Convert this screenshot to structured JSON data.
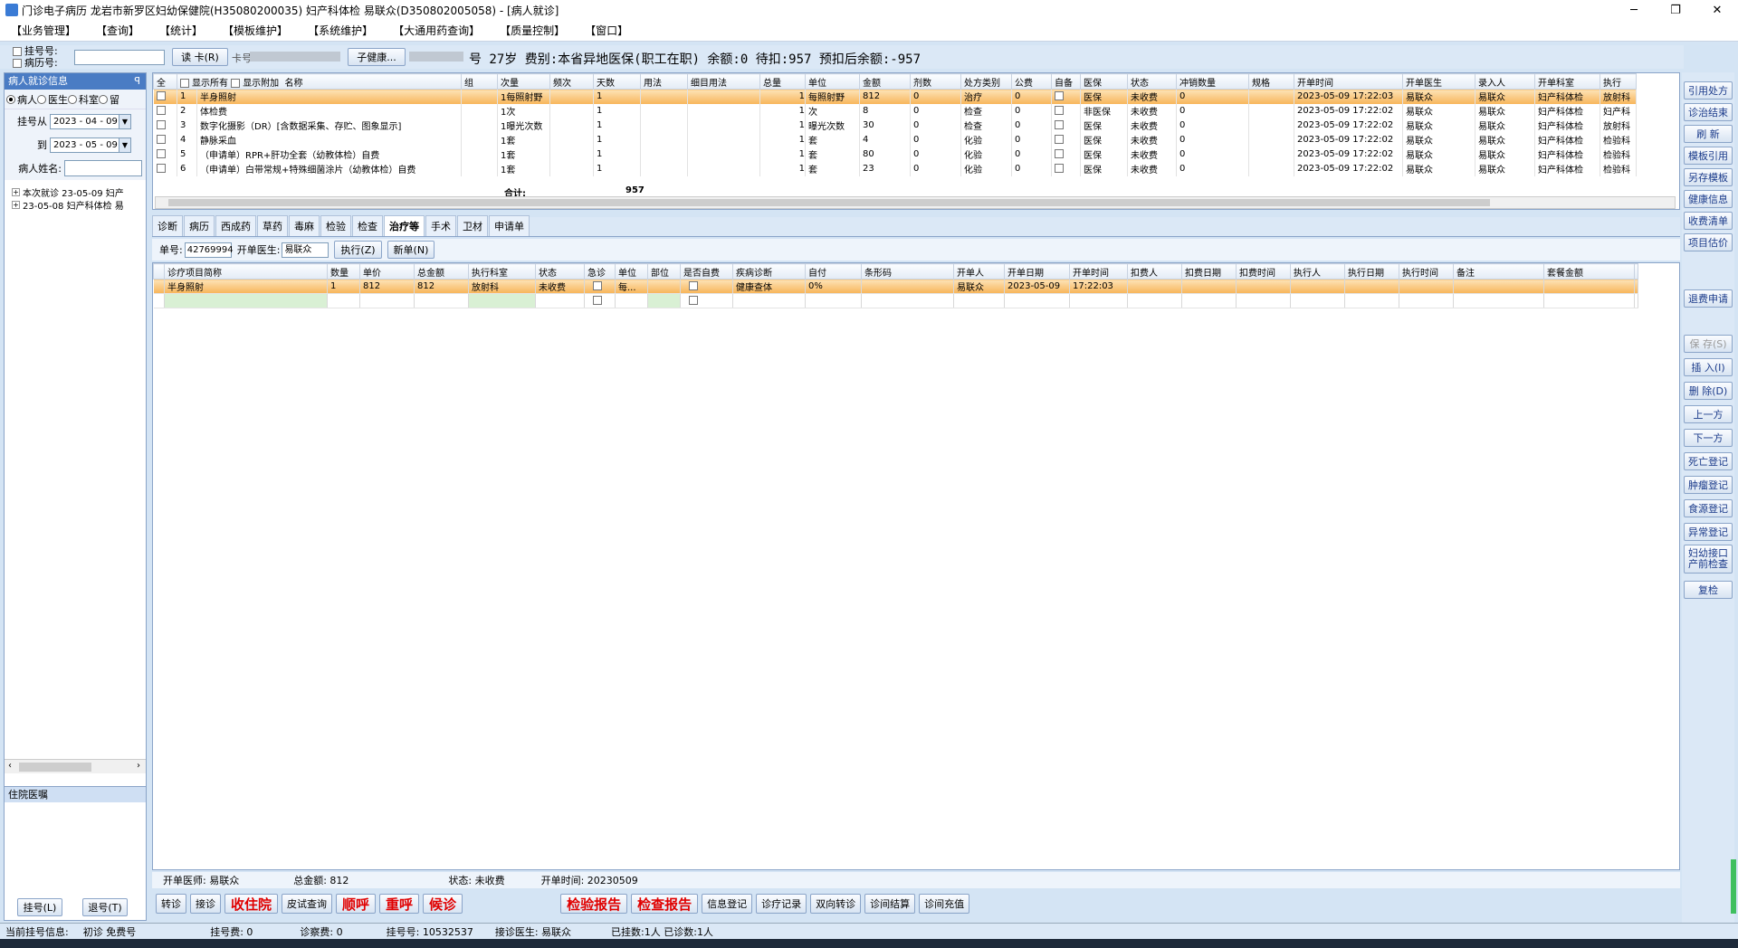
{
  "window": {
    "title": "门诊电子病历  龙岩市新罗区妇幼保健院(H35080200035)  妇产科体检  易联众(D350802005058) - [病人就诊]",
    "minimize": "─",
    "maximize": "❐",
    "close": "✕"
  },
  "menu": [
    "【业务管理】",
    "【查询】",
    "【统计】",
    "【模板维护】",
    "【系统维护】",
    "【大通用药查询】",
    "【质量控制】",
    "【窗口】"
  ],
  "info": {
    "reg_no_label": "挂号号:",
    "record_no_label": "病历号:",
    "read_card": "读 卡(R)",
    "card_label": "卡号",
    "health_card": "子健康...",
    "fee_text": "号 27岁  费别:本省异地医保(职工在职) 余额:0 待扣:957 预扣后余额:-957"
  },
  "left": {
    "header": "病人就诊信息",
    "pin": "ꟼ",
    "radios": [
      "病人",
      "医生",
      "科室",
      "留"
    ],
    "date_from_label": "挂号从",
    "date_from": "2023 - 04 - 09",
    "date_to_label": "到",
    "date_to": "2023 - 05 - 09",
    "name_label": "病人姓名:",
    "tree": [
      "本次就诊  23-05-09  妇产",
      "23-05-08  妇产科体检  易"
    ],
    "hospital_orders": "住院医嘱",
    "register_btn": "挂号(L)",
    "unregister_btn": "退号(T)"
  },
  "grid1": {
    "check_all": "全",
    "show_all": "显示所有",
    "show_attach": "显示附加",
    "columns": [
      "名称",
      "组",
      "次量",
      "频次",
      "天数",
      "用法",
      "细目用法",
      "总量",
      "单位",
      "金额",
      "剂数",
      "处方类别",
      "公费",
      "自备",
      "医保",
      "状态",
      "冲销数量",
      "规格",
      "开单时间",
      "开单医生",
      "录入人",
      "开单科室",
      "执行"
    ],
    "rows": [
      [
        "1",
        "半身照射",
        "",
        "1每照射野",
        "",
        "1",
        "",
        "",
        "1",
        "每照射野",
        "812",
        "0",
        "治疗",
        "0",
        "",
        "医保",
        "未收费",
        "0",
        "",
        "2023-05-09  17:22:03",
        "易联众",
        "易联众",
        "妇产科体检",
        "放射科"
      ],
      [
        "2",
        "体检费",
        "",
        "1次",
        "",
        "1",
        "",
        "",
        "1",
        "次",
        "8",
        "0",
        "检查",
        "0",
        "",
        "非医保",
        "未收费",
        "0",
        "",
        "2023-05-09  17:22:02",
        "易联众",
        "易联众",
        "妇产科体检",
        "妇产科"
      ],
      [
        "3",
        "数字化摄影（DR）[含数据采集、存贮、图象显示]",
        "",
        "1曝光次数",
        "",
        "1",
        "",
        "",
        "1",
        "曝光次数",
        "30",
        "0",
        "检查",
        "0",
        "",
        "医保",
        "未收费",
        "0",
        "",
        "2023-05-09  17:22:02",
        "易联众",
        "易联众",
        "妇产科体检",
        "放射科"
      ],
      [
        "4",
        "静脉采血",
        "",
        "1套",
        "",
        "1",
        "",
        "",
        "1",
        "套",
        "4",
        "0",
        "化验",
        "0",
        "",
        "医保",
        "未收费",
        "0",
        "",
        "2023-05-09  17:22:02",
        "易联众",
        "易联众",
        "妇产科体检",
        "检验科"
      ],
      [
        "5",
        "（申请单）RPR+肝功全套（幼教体检）自费",
        "",
        "1套",
        "",
        "1",
        "",
        "",
        "1",
        "套",
        "80",
        "0",
        "化验",
        "0",
        "",
        "医保",
        "未收费",
        "0",
        "",
        "2023-05-09  17:22:02",
        "易联众",
        "易联众",
        "妇产科体检",
        "检验科"
      ],
      [
        "6",
        "（申请单）白带常规+特殊细菌涂片（幼教体检）自费",
        "",
        "1套",
        "",
        "1",
        "",
        "",
        "1",
        "套",
        "23",
        "0",
        "化验",
        "0",
        "",
        "医保",
        "未收费",
        "0",
        "",
        "2023-05-09  17:22:02",
        "易联众",
        "易联众",
        "妇产科体检",
        "检验科"
      ]
    ],
    "total_label": "合计:",
    "total_value": "957"
  },
  "tabs": [
    "诊断",
    "病历",
    "西成药",
    "草药",
    "毒麻",
    "检验",
    "检查",
    "治疗等",
    "手术",
    "卫材",
    "申请单"
  ],
  "active_tab": "治疗等",
  "subbar": {
    "order_no_label": "单号:",
    "order_no": "42769994",
    "doctor_label": "开单医生:",
    "doctor": "易联众",
    "execute_btn": "执行(Z)",
    "new_btn": "新单(N)"
  },
  "grid2": {
    "columns": [
      "诊疗项目简称",
      "数量",
      "单价",
      "总金额",
      "执行科室",
      "状态",
      "急诊",
      "单位",
      "部位",
      "是否自费",
      "疾病诊断",
      "自付",
      "条形码",
      "开单人",
      "开单日期",
      "开单时间",
      "扣费人",
      "扣费日期",
      "扣费时间",
      "执行人",
      "执行日期",
      "执行时间",
      "备注",
      "套餐金额"
    ],
    "rows": [
      [
        "半身照射",
        "1",
        "812",
        "812",
        "放射科",
        "未收费",
        "",
        "每...",
        "",
        "",
        "健康查体",
        "0%",
        "",
        "易联众",
        "2023-05-09",
        "17:22:03",
        "",
        "",
        "",
        "",
        "",
        "",
        "",
        ""
      ]
    ]
  },
  "status": {
    "doctor": "开单医师:  易联众",
    "total": "总金额:  812",
    "state": "状态:  未收费",
    "time": "开单时间:  20230509"
  },
  "bottom_buttons": [
    {
      "label": "转诊",
      "red": false
    },
    {
      "label": "接诊",
      "red": false
    },
    {
      "label": "收住院",
      "red": true
    },
    {
      "label": "皮试查询",
      "red": false
    },
    {
      "label": "顺呼",
      "red": true
    },
    {
      "label": "重呼",
      "red": true
    },
    {
      "label": "候诊",
      "red": true
    },
    {
      "label": "检验报告",
      "red": true
    },
    {
      "label": "检查报告",
      "red": true
    },
    {
      "label": "信息登记",
      "red": false
    },
    {
      "label": "诊疗记录",
      "red": false
    },
    {
      "label": "双向转诊",
      "red": false
    },
    {
      "label": "诊间结算",
      "red": false
    },
    {
      "label": "诊间充值",
      "red": false
    }
  ],
  "right_buttons": [
    "引用处方",
    "诊治结束",
    "刷 新",
    "模板引用",
    "另存模板",
    "健康信息",
    "收费清单",
    "项目估价",
    "退费申请",
    "保 存(S)",
    "插 入(I)",
    "删 除(D)",
    "上一方",
    "下一方",
    "死亡登记",
    "肿瘤登记",
    "食源登记",
    "异常登记",
    "妇幼接口产前检查",
    "复检"
  ],
  "statusbar": {
    "current": "当前挂号信息:",
    "first_visit": "初诊  免费号",
    "reg_fee": "挂号费:    0",
    "diag_fee": "诊察费:    0",
    "reg_no": "挂号号:    10532537",
    "doctor": "接诊医生:    易联众",
    "counts": "已挂数:1人   已诊数:1人"
  }
}
